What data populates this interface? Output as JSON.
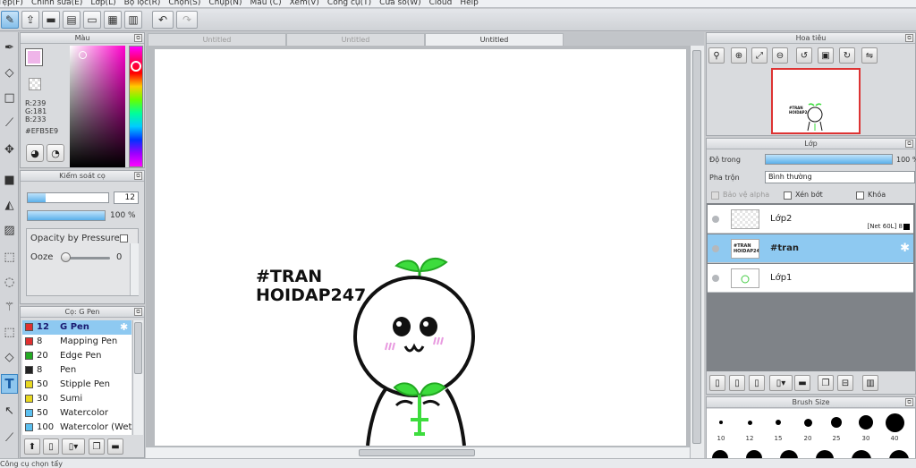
{
  "menu": [
    "Tệp(F)",
    "Chỉnh sửa(E)",
    "Lớp(L)",
    "Bộ lọc(R)",
    "Chọn(S)",
    "Chụp(N)",
    "Màu (C)",
    "Xem(V)",
    "Công cụ(T)",
    "Cửa sổ(W)",
    "Cloud",
    "Help"
  ],
  "color_panel": {
    "title": "Màu",
    "r": "R:239",
    "g": "G:181",
    "b": "B:233",
    "hex": "#EFB5E9",
    "fg_color": "#EFB5E9"
  },
  "brush_control": {
    "title": "Kiểm soát cọ",
    "size_value": "12",
    "opacity_value": "100 %",
    "opacity_pressure_label": "Opacity by Pressure",
    "ooze_label": "Ooze",
    "ooze_value": "0"
  },
  "brush_list": {
    "title": "Cọ: G Pen",
    "items": [
      {
        "size": "12",
        "name": "G Pen",
        "color": "#e03030"
      },
      {
        "size": "8",
        "name": "Mapping Pen",
        "color": "#e03030"
      },
      {
        "size": "20",
        "name": "Edge Pen",
        "color": "#22aa22"
      },
      {
        "size": "8",
        "name": "Pen",
        "color": "#222222"
      },
      {
        "size": "50",
        "name": "Stipple Pen",
        "color": "#e8d820"
      },
      {
        "size": "30",
        "name": "Sumi",
        "color": "#e8d820"
      },
      {
        "size": "50",
        "name": "Watercolor",
        "color": "#5bc0f0"
      },
      {
        "size": "100",
        "name": "Watercolor (Wet)",
        "color": "#5bc0f0"
      }
    ]
  },
  "tabs": [
    "Untitled",
    "Untitled",
    "Untitled"
  ],
  "artwork": {
    "line1": "#TRAN",
    "line2": "HOIDAP247"
  },
  "navigator": {
    "title": "Hoa tiêu"
  },
  "layer_panel": {
    "title": "Lớp",
    "opacity_label": "Độ trong",
    "opacity_value": "100 %",
    "blend_label": "Pha trộn",
    "blend_value": "Bình thường",
    "protect_alpha": "Bảo vệ alpha",
    "clip": "Xén bớt",
    "lock": "Khóa",
    "layers": [
      {
        "name": "Lớp2",
        "note": "[Net 60L] 8"
      },
      {
        "name": "#tran",
        "note": ""
      },
      {
        "name": "Lớp1",
        "note": ""
      }
    ],
    "thumb_text": "#TRAN HOIDAP247"
  },
  "brush_size": {
    "title": "Brush Size",
    "sizes": [
      "10",
      "12",
      "15",
      "20",
      "25",
      "30",
      "40"
    ]
  },
  "status": {
    "text": "Công cụ chọn tẩy"
  }
}
